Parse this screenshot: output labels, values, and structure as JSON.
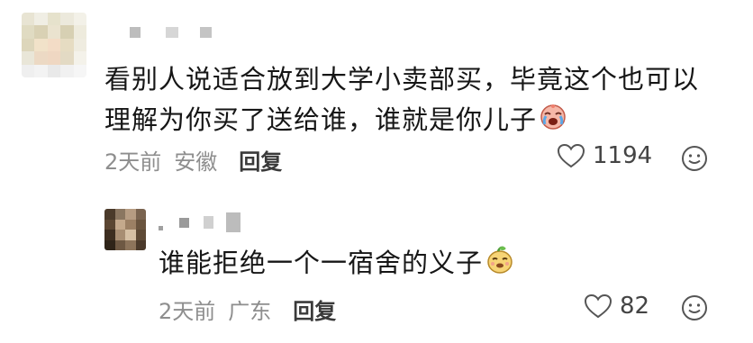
{
  "comments": [
    {
      "text_line1": "看别人说适合放到大学小卖部买，毕竟这个也可以",
      "text_line2": "理解为你买了送给谁，谁就是你儿子",
      "emoji": "crying-laughing-emoji",
      "time": "2天前",
      "location": "安徽",
      "reply_label": "回复",
      "likes": "1194"
    },
    {
      "text": "谁能拒绝一个一宿舍的义子",
      "emoji": "smug-emoji",
      "time": "2天前",
      "location": "广东",
      "reply_label": "回复",
      "likes": "82"
    }
  ],
  "colors": {
    "meta_gray": "#8e8e8e",
    "text": "#161616",
    "icon_gray": "#555555"
  }
}
